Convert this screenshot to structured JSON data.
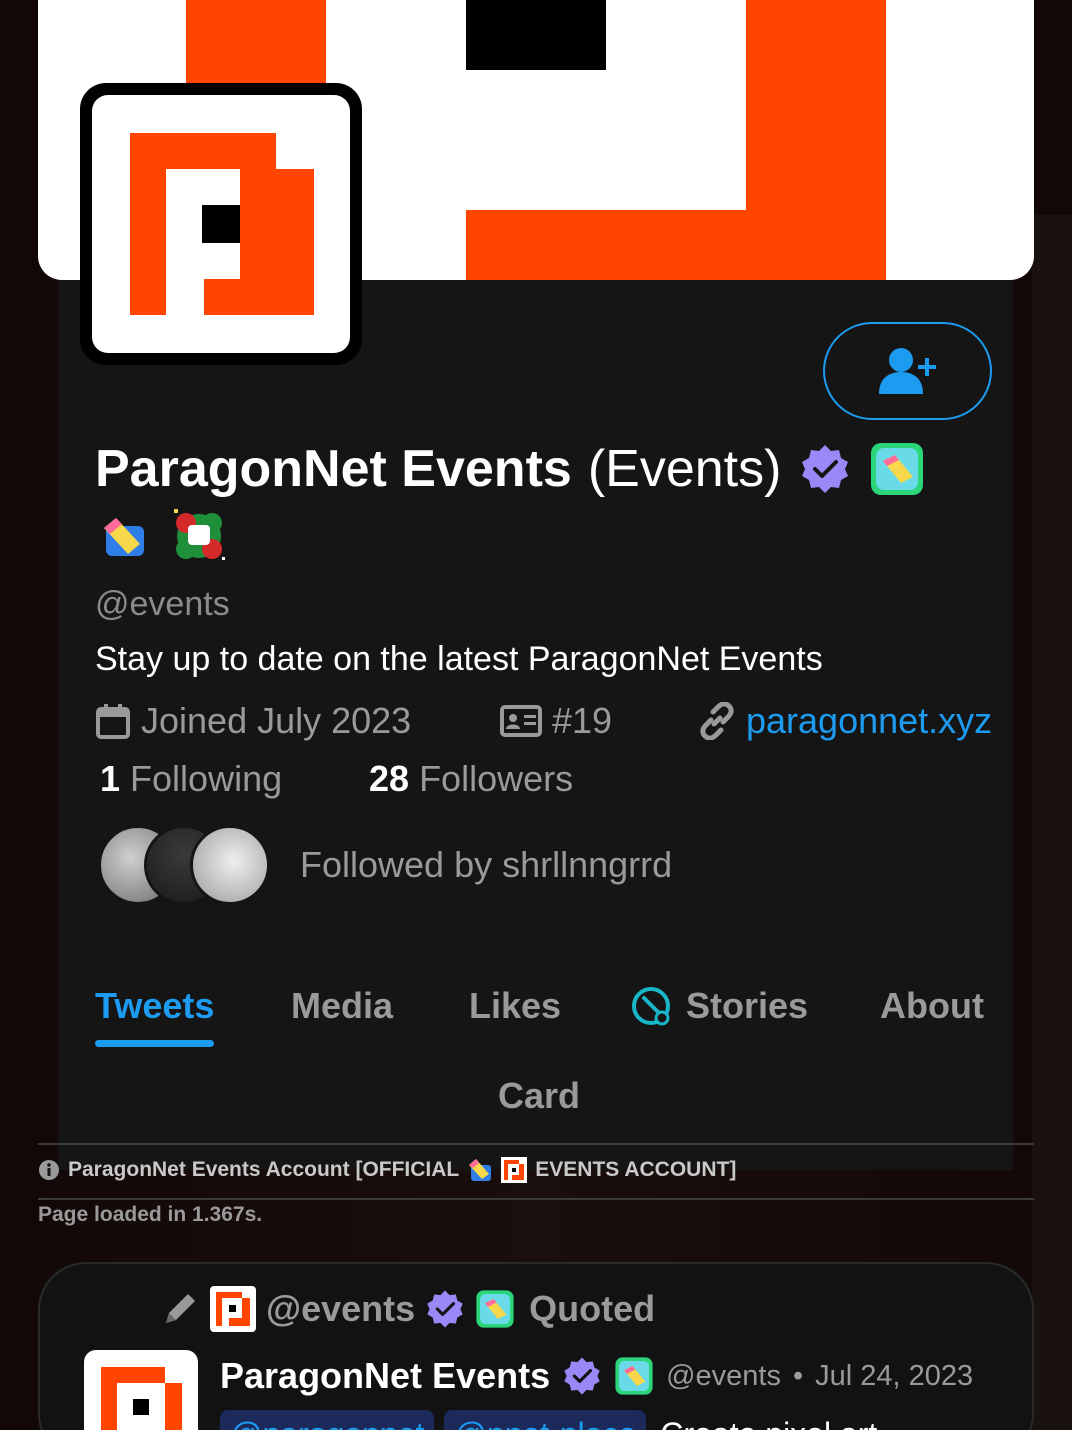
{
  "profile": {
    "name": "ParagonNet Events",
    "name_suffix": "(Events)",
    "handle": "@events",
    "bio": "Stay up to date on the latest ParagonNet Events",
    "joined": "Joined July 2023",
    "member_number": "#19",
    "website": "paragonnet.xyz",
    "following_count": "1",
    "following_label": "Following",
    "followers_count": "28",
    "followers_label": "Followers",
    "followed_by": "Followed by shrllnngrrd"
  },
  "tabs": [
    {
      "label": "Tweets",
      "active": true
    },
    {
      "label": "Media"
    },
    {
      "label": "Likes"
    },
    {
      "label": "Stories"
    },
    {
      "label": "About"
    },
    {
      "label": "Card"
    }
  ],
  "info": {
    "account_note_prefix": "ParagonNet Events Account [OFFICIAL",
    "account_note_suffix": "EVENTS ACCOUNT]",
    "page_loaded": "Page loaded in 1.367s."
  },
  "tweet": {
    "quote_handle": "@events",
    "quote_label": "Quoted",
    "author": "ParagonNet Events",
    "author_handle": "@events",
    "date": "Jul 24, 2023",
    "separator": "•",
    "mentions": [
      "@paragonnet",
      "@pnet-place"
    ],
    "text": "Create pixel art"
  },
  "colors": {
    "accent": "#1d9bf0",
    "brand_orange": "#ff4500",
    "verified_purple": "#9b87f5",
    "background": "#151515"
  },
  "icons": [
    "user-plus-icon",
    "verified-icon",
    "app-badge-icon",
    "calendar-icon",
    "id-card-icon",
    "link-icon",
    "stories-icon",
    "info-icon",
    "pencil-icon"
  ]
}
